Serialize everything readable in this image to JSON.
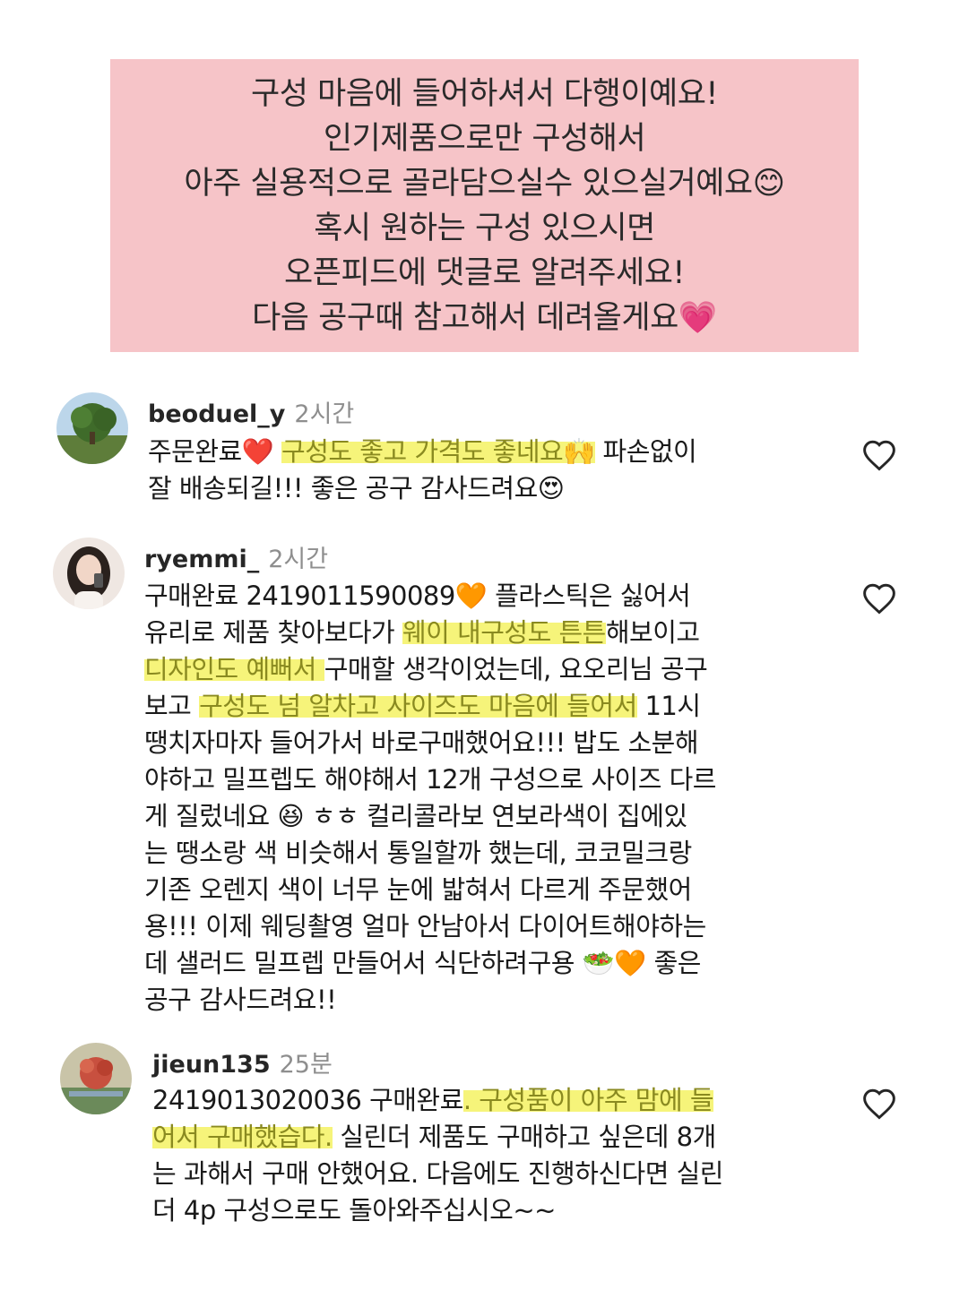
{
  "banner": {
    "lines": [
      "구성 마음에 들어하셔서 다행이예요!",
      "인기제품으로만 구성해서",
      "아주 실용적으로 골라담으실수 있으실거예요😊",
      "혹시 원하는 구성 있으시면",
      "오픈피드에 댓글로 알려주세요!",
      "다음 공구때 참고해서 데려올게요💗"
    ]
  },
  "comments": [
    {
      "username": "beoduel_y",
      "time": "2시간",
      "lines": [
        [
          {
            "t": "주문완료❤️ "
          },
          {
            "t": "구성도 좋고 가격도 좋네요🙌",
            "h": true
          },
          {
            "t": " 파손없이"
          }
        ],
        [
          {
            "t": "잘 배송되길!!! 좋은 공구 감사드려요😍"
          }
        ]
      ]
    },
    {
      "username": "ryemmi_",
      "time": "2시간",
      "lines": [
        [
          {
            "t": "구매완료 2419011590089🧡 플라스틱은 싫어서"
          }
        ],
        [
          {
            "t": "유리로 제품 찾아보다가 "
          },
          {
            "t": "웨이 내구성도 튼튼",
            "h": true
          },
          {
            "t": "해보이고"
          }
        ],
        [
          {
            "t": "디자인도 예뻐서 ",
            "h": true
          },
          {
            "t": "구매할 생각이었는데, 요오리님 공구"
          }
        ],
        [
          {
            "t": "보고 "
          },
          {
            "t": "구성도 넘 알차고 사이즈도 마음에 들어서",
            "h": true
          },
          {
            "t": " 11시"
          }
        ],
        [
          {
            "t": "땡치자마자 들어가서 바로구매했어요!!! 밥도 소분해"
          }
        ],
        [
          {
            "t": "야하고 밀프렙도 해야해서 12개 구성으로 사이즈 다르"
          }
        ],
        [
          {
            "t": "게 질렀네요 😆 ㅎㅎ 컬리콜라보 연보라색이 집에있"
          }
        ],
        [
          {
            "t": "는 땡소랑 색 비슷해서 통일할까 했는데, 코코밀크랑"
          }
        ],
        [
          {
            "t": "기존 오렌지 색이 너무 눈에 밟혀서 다르게 주문했어"
          }
        ],
        [
          {
            "t": "용!!! 이제 웨딩촬영 얼마 안남아서 다이어트해야하는"
          }
        ],
        [
          {
            "t": "데 샐러드 밀프렙 만들어서 식단하려구용 🥗🧡 좋은"
          }
        ],
        [
          {
            "t": "공구 감사드려요!!"
          }
        ]
      ]
    },
    {
      "username": "jieun135",
      "time": "25분",
      "lines": [
        [
          {
            "t": "2419013020036 구매완료"
          },
          {
            "t": ". 구성품이 아주 맘에 들",
            "h": true
          }
        ],
        [
          {
            "t": "어서 구매했습다.",
            "h": true
          },
          {
            "t": " 실린더 제품도 구매하고 싶은데 8개"
          }
        ],
        [
          {
            "t": "는 과해서 구매 안했어요. 다음에도 진행하신다면 실린"
          }
        ],
        [
          {
            "t": "더 4p 구성으로도 돌아와주십시오~~"
          }
        ]
      ]
    }
  ]
}
